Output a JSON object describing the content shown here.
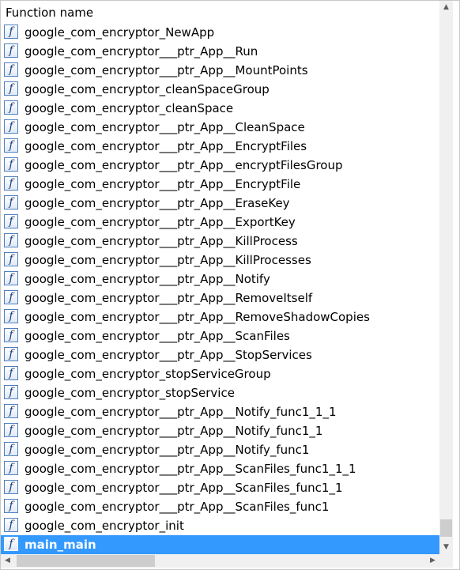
{
  "header": {
    "column_title": "Function name"
  },
  "icon": {
    "glyph": "f",
    "name": "function-icon"
  },
  "functions": [
    "google_com_encryptor_NewApp",
    "google_com_encryptor___ptr_App__Run",
    "google_com_encryptor___ptr_App__MountPoints",
    "google_com_encryptor_cleanSpaceGroup",
    "google_com_encryptor_cleanSpace",
    "google_com_encryptor___ptr_App__CleanSpace",
    "google_com_encryptor___ptr_App__EncryptFiles",
    "google_com_encryptor___ptr_App__encryptFilesGroup",
    "google_com_encryptor___ptr_App__EncryptFile",
    "google_com_encryptor___ptr_App__EraseKey",
    "google_com_encryptor___ptr_App__ExportKey",
    "google_com_encryptor___ptr_App__KillProcess",
    "google_com_encryptor___ptr_App__KillProcesses",
    "google_com_encryptor___ptr_App__Notify",
    "google_com_encryptor___ptr_App__RemoveItself",
    "google_com_encryptor___ptr_App__RemoveShadowCopies",
    "google_com_encryptor___ptr_App__ScanFiles",
    "google_com_encryptor___ptr_App__StopServices",
    "google_com_encryptor_stopServiceGroup",
    "google_com_encryptor_stopService",
    "google_com_encryptor___ptr_App__Notify_func1_1_1",
    "google_com_encryptor___ptr_App__Notify_func1_1",
    "google_com_encryptor___ptr_App__Notify_func1",
    "google_com_encryptor___ptr_App__ScanFiles_func1_1_1",
    "google_com_encryptor___ptr_App__ScanFiles_func1_1",
    "google_com_encryptor___ptr_App__ScanFiles_func1",
    "google_com_encryptor_init",
    "main_main"
  ],
  "selected_function": "main_main",
  "scrollbars": {
    "up_arrow": "▲",
    "down_arrow": "▼",
    "left_arrow": "◀",
    "right_arrow": "▶"
  },
  "colors": {
    "selection": "#3399ff",
    "icon_border": "#4f7fbf"
  }
}
